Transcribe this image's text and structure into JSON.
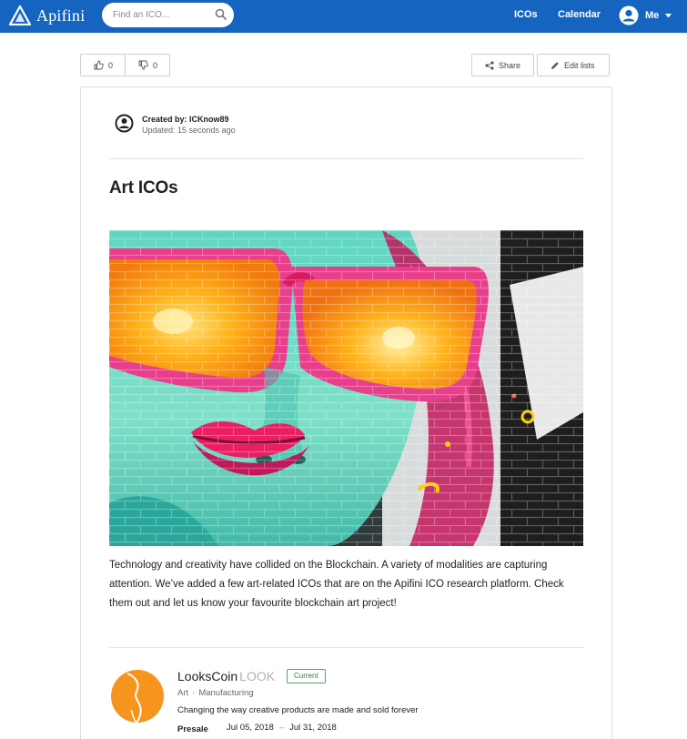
{
  "nav": {
    "brand": "Apifini",
    "search_placeholder": "Find an ICO...",
    "links": [
      "ICOs",
      "Calendar"
    ],
    "user_label": "Me"
  },
  "toolbar": {
    "upvotes": "0",
    "downvotes": "0",
    "share_label": "Share",
    "edit_label": "Edit lists"
  },
  "list": {
    "created_by": "Created by: ICKnow89",
    "updated": "Updated: 15 seconds ago",
    "title": "Art ICOs",
    "description": "Technology and creativity have collided on the Blockchain. A variety of modalities are capturing attention. We’ve added a few art-related ICOs that are on the Apifini ICO research platform. Check them out and let us know your favourite blockchain art project!"
  },
  "icos": [
    {
      "name": "LooksCoin",
      "ticker": "LOOK",
      "status": "Current",
      "category": "Art",
      "industry": "Manufacturing",
      "tagline": "Changing the way creative products are made and sold forever",
      "stage": "Presale",
      "start_date": "Jul 05, 2018",
      "end_date": "Jul 31, 2018"
    }
  ],
  "colors": {
    "brand_blue": "#1565c0",
    "badge_green": "#4caf50",
    "logo_orange": "#f7941d"
  }
}
